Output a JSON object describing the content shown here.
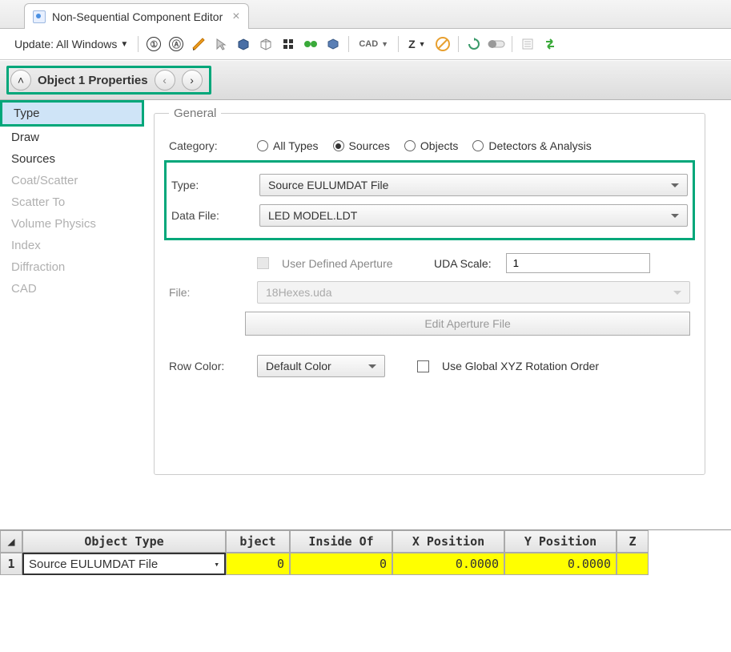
{
  "tab": {
    "title": "Non-Sequential Component Editor"
  },
  "toolbar": {
    "update_label": "Update: All Windows",
    "cad_label": "CAD",
    "z_label": "Z"
  },
  "propbar": {
    "title": "Object   1 Properties"
  },
  "sidebar": {
    "items": [
      {
        "label": "Type",
        "state": "selected"
      },
      {
        "label": "Draw",
        "state": ""
      },
      {
        "label": "Sources",
        "state": ""
      },
      {
        "label": "Coat/Scatter",
        "state": "disabled"
      },
      {
        "label": "Scatter To",
        "state": "disabled"
      },
      {
        "label": "Volume Physics",
        "state": "disabled"
      },
      {
        "label": "Index",
        "state": "disabled"
      },
      {
        "label": "Diffraction",
        "state": "disabled"
      },
      {
        "label": "CAD",
        "state": "disabled"
      }
    ]
  },
  "general": {
    "legend": "General",
    "category_label": "Category:",
    "categories": {
      "all_types": "All Types",
      "sources": "Sources",
      "objects": "Objects",
      "detectors": "Detectors & Analysis"
    },
    "type_label": "Type:",
    "type_value": "Source EULUMDAT File",
    "datafile_label": "Data File:",
    "datafile_value": "LED MODEL.LDT",
    "uda_check_label": "User Defined Aperture",
    "uda_scale_label": "UDA Scale:",
    "uda_scale_value": "1",
    "file_label": "File:",
    "file_value": "18Hexes.uda",
    "edit_aperture_label": "Edit Aperture File",
    "rowcolor_label": "Row Color:",
    "rowcolor_value": "Default Color",
    "global_xyz_label": "Use Global XYZ Rotation Order"
  },
  "table": {
    "headers": {
      "objtype": "Object Type",
      "bject": "bject",
      "inside": "Inside Of",
      "xpos": "X Position",
      "ypos": "Y Position",
      "z": "Z"
    },
    "row1": {
      "num": "1",
      "objtype": "Source EULUMDAT File",
      "bject": "0",
      "inside": "0",
      "xpos": "0.0000",
      "ypos": "0.0000"
    }
  }
}
